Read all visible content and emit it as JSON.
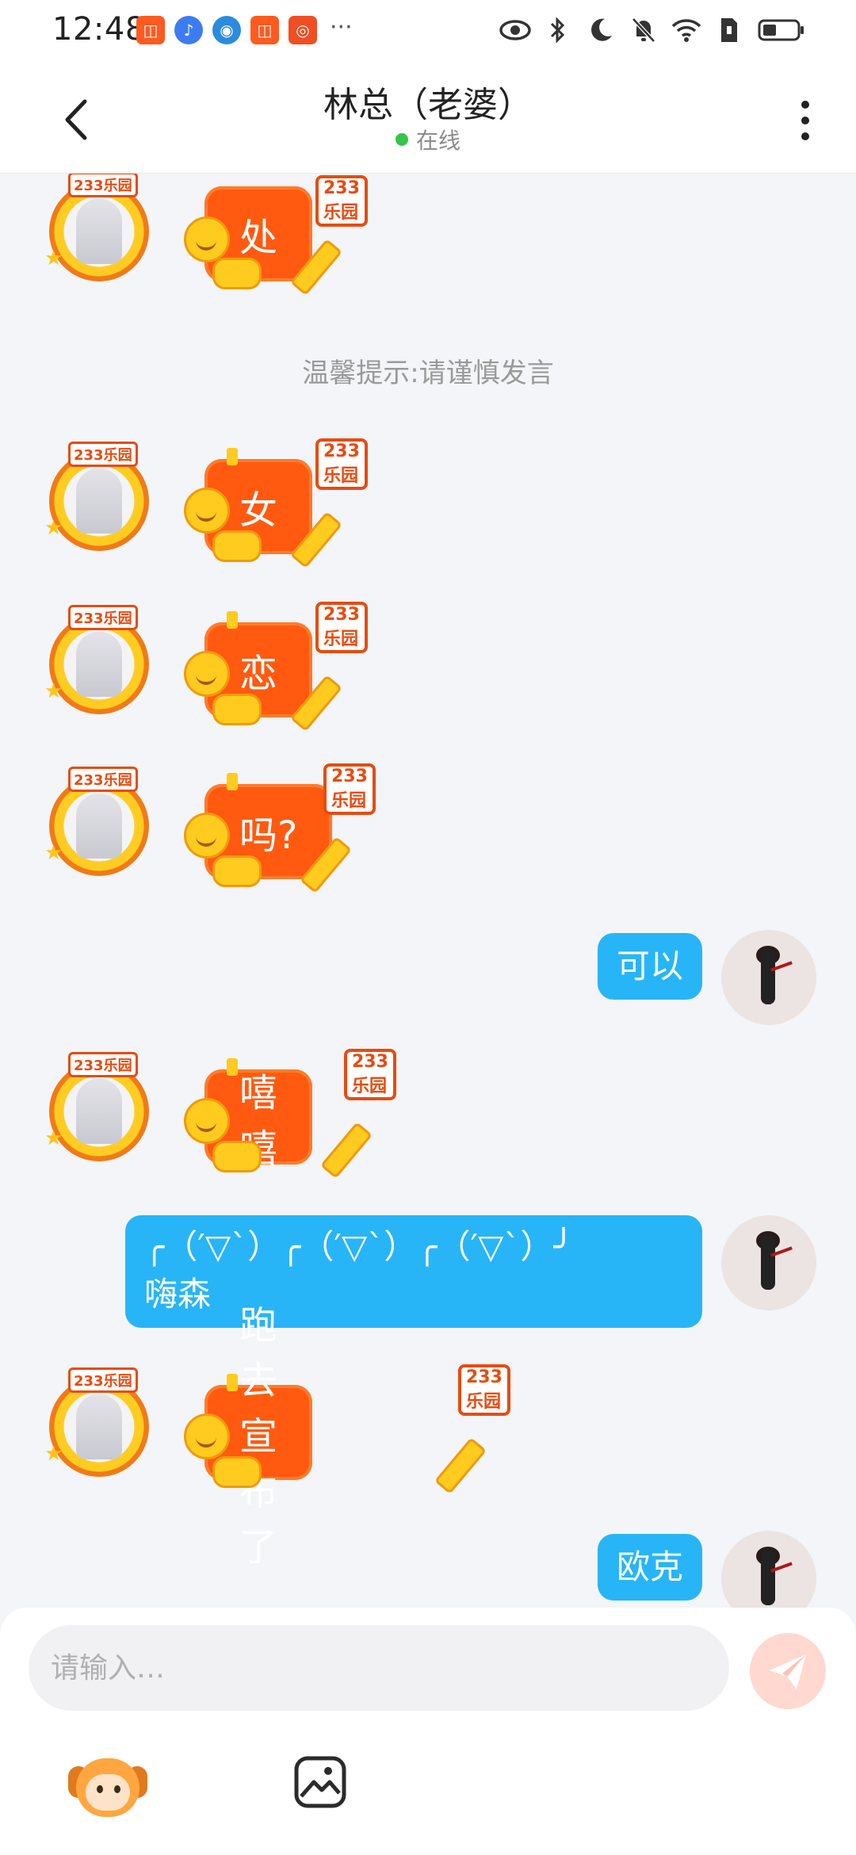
{
  "status_bar": {
    "time": "12:48",
    "apps": [
      {
        "icon": "square-app-icon",
        "color": "#ff5a1f",
        "glyph": "◫"
      },
      {
        "icon": "music-icon",
        "color": "#3c7cf0",
        "glyph": "♪"
      },
      {
        "icon": "browser-icon",
        "color": "#2a8be0",
        "glyph": "◉"
      },
      {
        "icon": "square-app-icon",
        "color": "#ff5a1f",
        "glyph": "◫"
      },
      {
        "icon": "instagram-icon",
        "color": "#f04e23",
        "glyph": "◎"
      }
    ],
    "more": "···"
  },
  "header": {
    "title": "林总（老婆）",
    "status": "在线",
    "status_color": "#34c54a"
  },
  "chat": {
    "tip": "温馨提示:请谨慎发言",
    "messages": [
      {
        "dir": "in",
        "type": "sticker",
        "text": "处",
        "tag": "233乐园"
      },
      {
        "dir": "in",
        "type": "sticker",
        "text": "女",
        "tag": "233乐园"
      },
      {
        "dir": "in",
        "type": "sticker",
        "text": "恋",
        "tag": "233乐园"
      },
      {
        "dir": "in",
        "type": "sticker",
        "text": "吗?",
        "tag": "233乐园"
      },
      {
        "dir": "out",
        "type": "text",
        "text": "可以"
      },
      {
        "dir": "in",
        "type": "sticker",
        "text": "嘻嘻",
        "tag": "233乐园"
      },
      {
        "dir": "out",
        "type": "text",
        "line1": "╭（′▽`）╭（′▽`）╭（′▽`）╯",
        "line2": "嗨森"
      },
      {
        "dir": "in",
        "type": "sticker",
        "text": "跑去宣布了",
        "tag": "233乐园"
      },
      {
        "dir": "out",
        "type": "text",
        "text": "欧克"
      }
    ],
    "avatar_tag": "233乐园"
  },
  "composer": {
    "placeholder": "请输入…",
    "send_color": "#ffd9cf"
  },
  "colors": {
    "bubble_out": "#27b5f7",
    "sticker": "#ff5a10",
    "background": "#f3f5f8"
  }
}
